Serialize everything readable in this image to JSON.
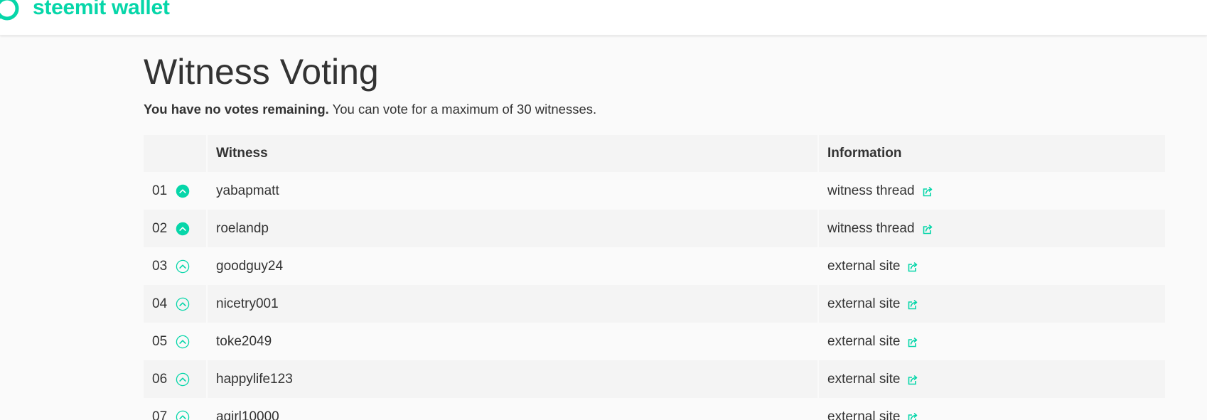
{
  "header": {
    "logo_text": "steemit wallet",
    "logo_icon": "steemit-logo-icon",
    "brand_color": "#06d6a9"
  },
  "page": {
    "title": "Witness Voting",
    "subtitle_bold": "You have no votes remaining.",
    "subtitle_rest": " You can vote for a maximum of 30 witnesses."
  },
  "table": {
    "columns": [
      "",
      "Witness",
      "Information"
    ],
    "rows": [
      {
        "rank": "01",
        "voted": true,
        "witness": "yabapmatt",
        "info": "witness thread"
      },
      {
        "rank": "02",
        "voted": true,
        "witness": "roelandp",
        "info": "witness thread"
      },
      {
        "rank": "03",
        "voted": false,
        "witness": "goodguy24",
        "info": "external site"
      },
      {
        "rank": "04",
        "voted": false,
        "witness": "nicetry001",
        "info": "external site"
      },
      {
        "rank": "05",
        "voted": false,
        "witness": "toke2049",
        "info": "external site"
      },
      {
        "rank": "06",
        "voted": false,
        "witness": "happylife123",
        "info": "external site"
      },
      {
        "rank": "07",
        "voted": false,
        "witness": "agirl10000",
        "info": "external site"
      }
    ],
    "icons": {
      "vote": "upvote-chevron-icon",
      "external": "external-link-icon"
    },
    "colors": {
      "accent": "#06d6a9",
      "row_alt": "#f4f4f4"
    }
  }
}
